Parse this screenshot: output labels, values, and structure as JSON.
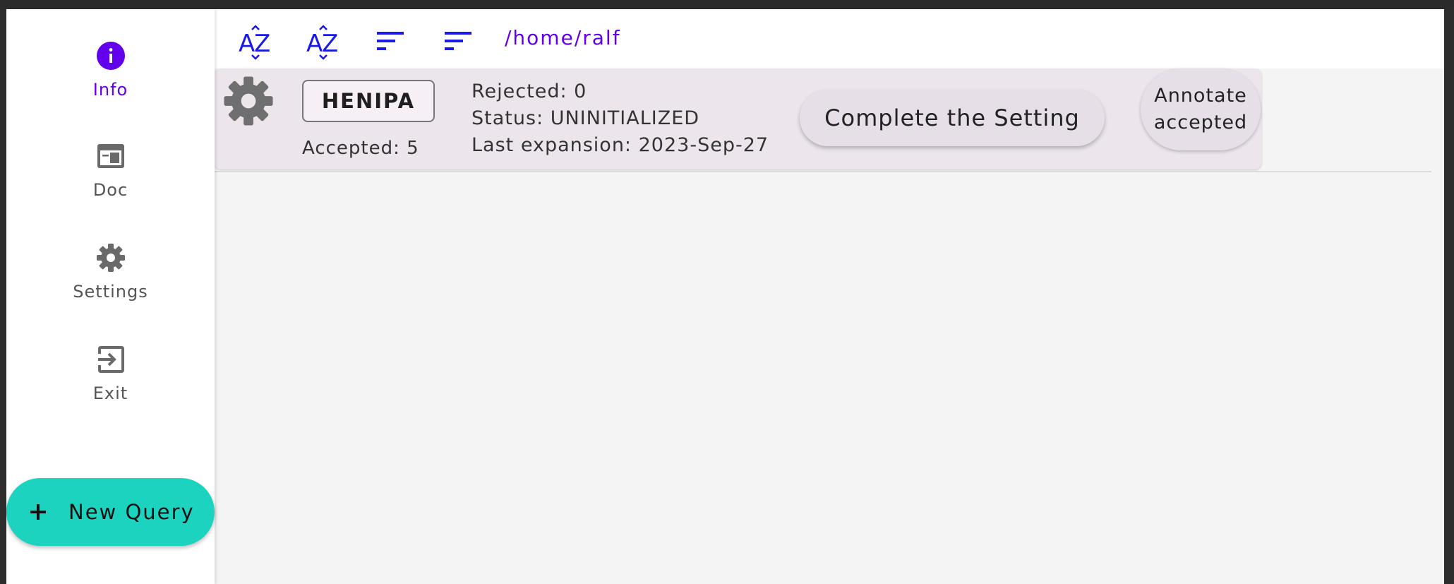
{
  "rail": {
    "items": [
      {
        "label": "Info",
        "icon": "info-icon",
        "active": true
      },
      {
        "label": "Doc",
        "icon": "doc-icon",
        "active": false
      },
      {
        "label": "Settings",
        "icon": "gear-icon",
        "active": false
      },
      {
        "label": "Exit",
        "icon": "exit-icon",
        "active": false
      }
    ],
    "fab_label": "New Query"
  },
  "toolbar": {
    "buttons": [
      {
        "icon": "sort-az-icon"
      },
      {
        "icon": "sort-az-icon"
      },
      {
        "icon": "sort-lines-icon"
      },
      {
        "icon": "sort-lines-icon"
      }
    ],
    "path": "/home/ralf"
  },
  "card": {
    "name": "HENIPA",
    "accepted": "Accepted: 5",
    "rejected": "Rejected: 0",
    "status": "Status: UNINITIALIZED",
    "last_expansion": "Last expansion: 2023-Sep-27",
    "complete_button": "Complete the Setting",
    "annotate_button_line1": "Annotate",
    "annotate_button_line2": "accepted"
  },
  "colors": {
    "accent": "#6200ee",
    "fab": "#1bd3bf",
    "toolbar_icon": "#1a1ae6",
    "icon_gray": "#707070"
  }
}
